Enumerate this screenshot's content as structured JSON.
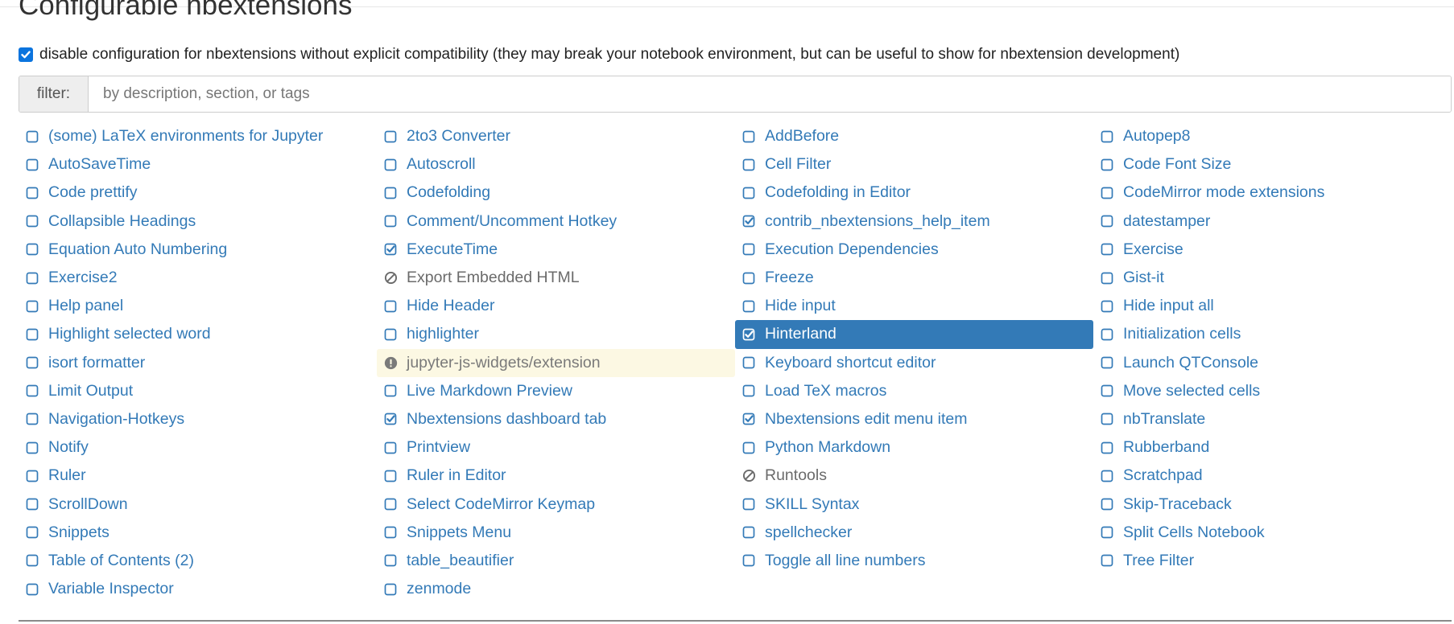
{
  "page": {
    "title": "Configurable nbextensions",
    "compat_checkbox_checked": true,
    "compat_label": "disable configuration for nbextensions without explicit compatibility (they may break your notebook environment, but can be useful to show for nbextension development)"
  },
  "filter": {
    "label": "filter:",
    "placeholder": "by description, section, or tags",
    "value": ""
  },
  "colors": {
    "link": "#337ab7",
    "selected_bg": "#337ab7",
    "warning_bg": "#fcf8e3",
    "native_checkbox": "#0b74de"
  },
  "extensions": [
    {
      "name": "(some) LaTeX environments for Jupyter",
      "state": "unchecked",
      "icon": "square-icon"
    },
    {
      "name": "2to3 Converter",
      "state": "unchecked",
      "icon": "square-icon"
    },
    {
      "name": "AddBefore",
      "state": "unchecked",
      "icon": "square-icon"
    },
    {
      "name": "Autopep8",
      "state": "unchecked",
      "icon": "square-icon"
    },
    {
      "name": "AutoSaveTime",
      "state": "unchecked",
      "icon": "square-icon"
    },
    {
      "name": "Autoscroll",
      "state": "unchecked",
      "icon": "square-icon"
    },
    {
      "name": "Cell Filter",
      "state": "unchecked",
      "icon": "square-icon"
    },
    {
      "name": "Code Font Size",
      "state": "unchecked",
      "icon": "square-icon"
    },
    {
      "name": "Code prettify",
      "state": "unchecked",
      "icon": "square-icon"
    },
    {
      "name": "Codefolding",
      "state": "unchecked",
      "icon": "square-icon"
    },
    {
      "name": "Codefolding in Editor",
      "state": "unchecked",
      "icon": "square-icon"
    },
    {
      "name": "CodeMirror mode extensions",
      "state": "unchecked",
      "icon": "square-icon"
    },
    {
      "name": "Collapsible Headings",
      "state": "unchecked",
      "icon": "square-icon"
    },
    {
      "name": "Comment/Uncomment Hotkey",
      "state": "unchecked",
      "icon": "square-icon"
    },
    {
      "name": "contrib_nbextensions_help_item",
      "state": "checked",
      "icon": "check-square-icon"
    },
    {
      "name": "datestamper",
      "state": "unchecked",
      "icon": "square-icon"
    },
    {
      "name": "Equation Auto Numbering",
      "state": "unchecked",
      "icon": "square-icon"
    },
    {
      "name": "ExecuteTime",
      "state": "checked",
      "icon": "check-square-icon"
    },
    {
      "name": "Execution Dependencies",
      "state": "unchecked",
      "icon": "square-icon"
    },
    {
      "name": "Exercise",
      "state": "unchecked",
      "icon": "square-icon"
    },
    {
      "name": "Exercise2",
      "state": "unchecked",
      "icon": "square-icon"
    },
    {
      "name": "Export Embedded HTML",
      "state": "disabled",
      "icon": "ban-icon"
    },
    {
      "name": "Freeze",
      "state": "unchecked",
      "icon": "square-icon"
    },
    {
      "name": "Gist-it",
      "state": "unchecked",
      "icon": "square-icon"
    },
    {
      "name": "Help panel",
      "state": "unchecked",
      "icon": "square-icon"
    },
    {
      "name": "Hide Header",
      "state": "unchecked",
      "icon": "square-icon"
    },
    {
      "name": "Hide input",
      "state": "unchecked",
      "icon": "square-icon"
    },
    {
      "name": "Hide input all",
      "state": "unchecked",
      "icon": "square-icon"
    },
    {
      "name": "Highlight selected word",
      "state": "unchecked",
      "icon": "square-icon"
    },
    {
      "name": "highlighter",
      "state": "unchecked",
      "icon": "square-icon"
    },
    {
      "name": "Hinterland",
      "state": "selected",
      "icon": "check-square-icon"
    },
    {
      "name": "Initialization cells",
      "state": "unchecked",
      "icon": "square-icon"
    },
    {
      "name": "isort formatter",
      "state": "unchecked",
      "icon": "square-icon"
    },
    {
      "name": "jupyter-js-widgets/extension",
      "state": "warning",
      "icon": "exclamation-circle-icon"
    },
    {
      "name": "Keyboard shortcut editor",
      "state": "unchecked",
      "icon": "square-icon"
    },
    {
      "name": "Launch QTConsole",
      "state": "unchecked",
      "icon": "square-icon"
    },
    {
      "name": "Limit Output",
      "state": "unchecked",
      "icon": "square-icon"
    },
    {
      "name": "Live Markdown Preview",
      "state": "unchecked",
      "icon": "square-icon"
    },
    {
      "name": "Load TeX macros",
      "state": "unchecked",
      "icon": "square-icon"
    },
    {
      "name": "Move selected cells",
      "state": "unchecked",
      "icon": "square-icon"
    },
    {
      "name": "Navigation-Hotkeys",
      "state": "unchecked",
      "icon": "square-icon"
    },
    {
      "name": "Nbextensions dashboard tab",
      "state": "checked",
      "icon": "check-square-icon"
    },
    {
      "name": "Nbextensions edit menu item",
      "state": "checked",
      "icon": "check-square-icon"
    },
    {
      "name": "nbTranslate",
      "state": "unchecked",
      "icon": "square-icon"
    },
    {
      "name": "Notify",
      "state": "unchecked",
      "icon": "square-icon"
    },
    {
      "name": "Printview",
      "state": "unchecked",
      "icon": "square-icon"
    },
    {
      "name": "Python Markdown",
      "state": "unchecked",
      "icon": "square-icon"
    },
    {
      "name": "Rubberband",
      "state": "unchecked",
      "icon": "square-icon"
    },
    {
      "name": "Ruler",
      "state": "unchecked",
      "icon": "square-icon"
    },
    {
      "name": "Ruler in Editor",
      "state": "unchecked",
      "icon": "square-icon"
    },
    {
      "name": "Runtools",
      "state": "disabled",
      "icon": "ban-icon"
    },
    {
      "name": "Scratchpad",
      "state": "unchecked",
      "icon": "square-icon"
    },
    {
      "name": "ScrollDown",
      "state": "unchecked",
      "icon": "square-icon"
    },
    {
      "name": "Select CodeMirror Keymap",
      "state": "unchecked",
      "icon": "square-icon"
    },
    {
      "name": "SKILL Syntax",
      "state": "unchecked",
      "icon": "square-icon"
    },
    {
      "name": "Skip-Traceback",
      "state": "unchecked",
      "icon": "square-icon"
    },
    {
      "name": "Snippets",
      "state": "unchecked",
      "icon": "square-icon"
    },
    {
      "name": "Snippets Menu",
      "state": "unchecked",
      "icon": "square-icon"
    },
    {
      "name": "spellchecker",
      "state": "unchecked",
      "icon": "square-icon"
    },
    {
      "name": "Split Cells Notebook",
      "state": "unchecked",
      "icon": "square-icon"
    },
    {
      "name": "Table of Contents (2)",
      "state": "unchecked",
      "icon": "square-icon"
    },
    {
      "name": "table_beautifier",
      "state": "unchecked",
      "icon": "square-icon"
    },
    {
      "name": "Toggle all line numbers",
      "state": "unchecked",
      "icon": "square-icon"
    },
    {
      "name": "Tree Filter",
      "state": "unchecked",
      "icon": "square-icon"
    },
    {
      "name": "Variable Inspector",
      "state": "unchecked",
      "icon": "square-icon"
    },
    {
      "name": "zenmode",
      "state": "unchecked",
      "icon": "square-icon"
    }
  ]
}
